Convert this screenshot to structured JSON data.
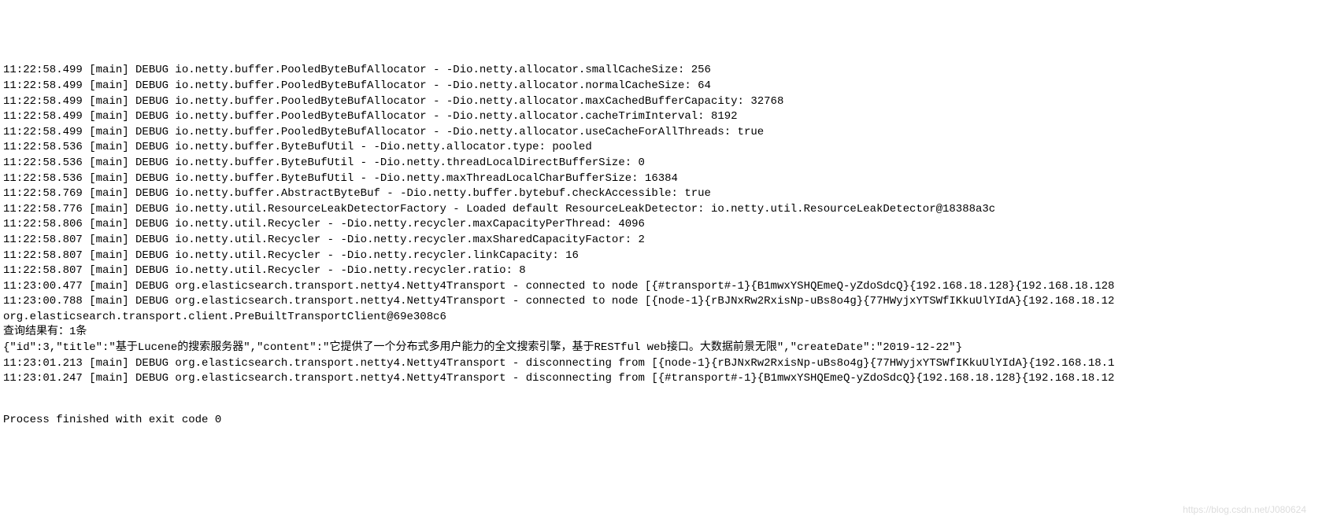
{
  "lines": [
    {
      "cls": "log-line",
      "text": "11:22:58.499 [main] DEBUG io.netty.buffer.PooledByteBufAllocator - -Dio.netty.allocator.smallCacheSize: 256"
    },
    {
      "cls": "log-line",
      "text": "11:22:58.499 [main] DEBUG io.netty.buffer.PooledByteBufAllocator - -Dio.netty.allocator.normalCacheSize: 64"
    },
    {
      "cls": "log-line",
      "text": "11:22:58.499 [main] DEBUG io.netty.buffer.PooledByteBufAllocator - -Dio.netty.allocator.maxCachedBufferCapacity: 32768"
    },
    {
      "cls": "log-line",
      "text": "11:22:58.499 [main] DEBUG io.netty.buffer.PooledByteBufAllocator - -Dio.netty.allocator.cacheTrimInterval: 8192"
    },
    {
      "cls": "log-line",
      "text": "11:22:58.499 [main] DEBUG io.netty.buffer.PooledByteBufAllocator - -Dio.netty.allocator.useCacheForAllThreads: true"
    },
    {
      "cls": "log-line",
      "text": "11:22:58.536 [main] DEBUG io.netty.buffer.ByteBufUtil - -Dio.netty.allocator.type: pooled"
    },
    {
      "cls": "log-line",
      "text": "11:22:58.536 [main] DEBUG io.netty.buffer.ByteBufUtil - -Dio.netty.threadLocalDirectBufferSize: 0"
    },
    {
      "cls": "log-line",
      "text": "11:22:58.536 [main] DEBUG io.netty.buffer.ByteBufUtil - -Dio.netty.maxThreadLocalCharBufferSize: 16384"
    },
    {
      "cls": "log-line",
      "text": "11:22:58.769 [main] DEBUG io.netty.buffer.AbstractByteBuf - -Dio.netty.buffer.bytebuf.checkAccessible: true"
    },
    {
      "cls": "log-line",
      "text": "11:22:58.776 [main] DEBUG io.netty.util.ResourceLeakDetectorFactory - Loaded default ResourceLeakDetector: io.netty.util.ResourceLeakDetector@18388a3c"
    },
    {
      "cls": "log-line",
      "text": "11:22:58.806 [main] DEBUG io.netty.util.Recycler - -Dio.netty.recycler.maxCapacityPerThread: 4096"
    },
    {
      "cls": "log-line",
      "text": "11:22:58.807 [main] DEBUG io.netty.util.Recycler - -Dio.netty.recycler.maxSharedCapacityFactor: 2"
    },
    {
      "cls": "log-line",
      "text": "11:22:58.807 [main] DEBUG io.netty.util.Recycler - -Dio.netty.recycler.linkCapacity: 16"
    },
    {
      "cls": "log-line",
      "text": "11:22:58.807 [main] DEBUG io.netty.util.Recycler - -Dio.netty.recycler.ratio: 8"
    },
    {
      "cls": "log-line",
      "text": "11:23:00.477 [main] DEBUG org.elasticsearch.transport.netty4.Netty4Transport - connected to node [{#transport#-1}{B1mwxYSHQEmeQ-yZdoSdcQ}{192.168.18.128}{192.168.18.128"
    },
    {
      "cls": "log-line",
      "text": "11:23:00.788 [main] DEBUG org.elasticsearch.transport.netty4.Netty4Transport - connected to node [{node-1}{rBJNxRw2RxisNp-uBs8o4g}{77HWyjxYTSWfIKkuUlYIdA}{192.168.18.12"
    },
    {
      "cls": "output-line",
      "text": "org.elasticsearch.transport.client.PreBuiltTransportClient@69e308c6"
    },
    {
      "cls": "output-line",
      "text": "查询结果有：1条"
    },
    {
      "cls": "output-line",
      "text": "{\"id\":3,\"title\":\"基于Lucene的搜索服务器\",\"content\":\"它提供了一个分布式多用户能力的全文搜索引擎，基于RESTful web接口。大数据前景无限\",\"createDate\":\"2019-12-22\"}"
    },
    {
      "cls": "log-line",
      "text": "11:23:01.213 [main] DEBUG org.elasticsearch.transport.netty4.Netty4Transport - disconnecting from [{node-1}{rBJNxRw2RxisNp-uBs8o4g}{77HWyjxYTSWfIKkuUlYIdA}{192.168.18.1"
    },
    {
      "cls": "log-line",
      "text": "11:23:01.247 [main] DEBUG org.elasticsearch.transport.netty4.Netty4Transport - disconnecting from [{#transport#-1}{B1mwxYSHQEmeQ-yZdoSdcQ}{192.168.18.128}{192.168.18.12"
    }
  ],
  "final": "Process finished with exit code 0",
  "watermark": "https://blog.csdn.net/J080624"
}
